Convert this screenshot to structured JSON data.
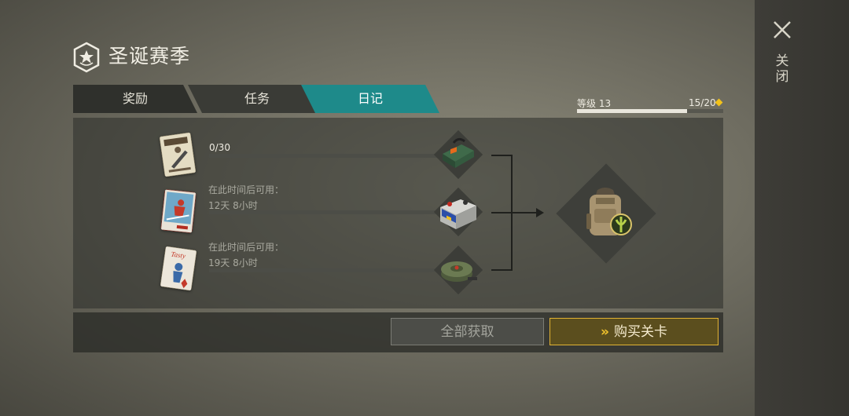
{
  "header": {
    "title": "圣诞赛季",
    "title_icon": "star-shield-icon"
  },
  "close": {
    "label": "关闭",
    "icon": "close-icon"
  },
  "tabs": [
    {
      "label": "奖励",
      "active": false
    },
    {
      "label": "任务",
      "active": false
    },
    {
      "label": "日记",
      "active": true
    }
  ],
  "level": {
    "label": "等级 13",
    "count": "15/20",
    "progress": 0.75,
    "icon": "diamond-icon"
  },
  "rows": [
    {
      "card_icon": "snowboard-poster-icon",
      "progress": "0/30",
      "line1": "",
      "line2": "",
      "reward_icon": "ammo-box-icon"
    },
    {
      "card_icon": "ski-poster-icon",
      "progress": "",
      "line1": "在此时间后可用：",
      "line2": "12天 8小时",
      "reward_icon": "battery-icon"
    },
    {
      "card_icon": "tasty-poster-icon",
      "progress": "",
      "line1": "在此时间后可用：",
      "line2": "19天 8小时",
      "reward_icon": "landmine-icon"
    }
  ],
  "final_reward": {
    "icon": "backpack-icon",
    "badge_icon": "green-emblem-icon"
  },
  "buttons": {
    "claim_all": "全部获取",
    "buy_level": "购买关卡",
    "buy_icon": "double-chevron-icon"
  },
  "colors": {
    "active_tab": "#1e8a8a",
    "accent_gold": "#e1b233",
    "diamond": "#f2c21b"
  }
}
